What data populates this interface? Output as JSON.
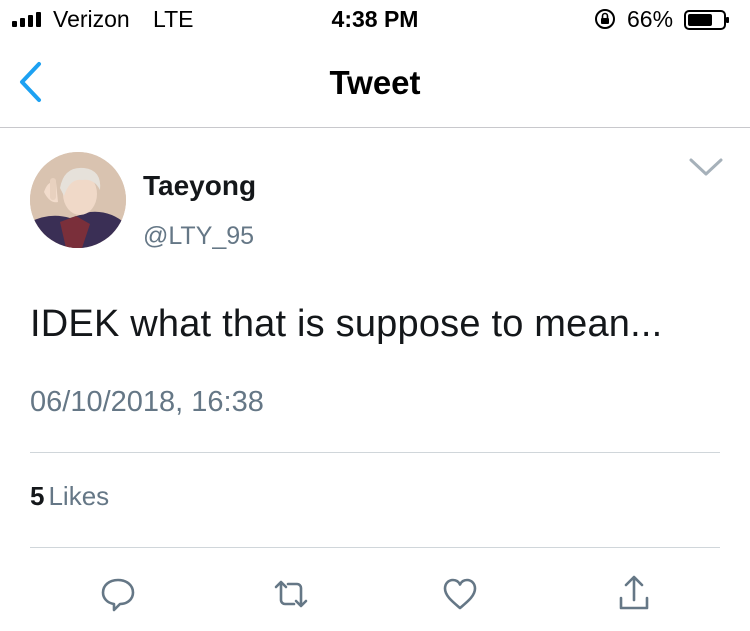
{
  "status_bar": {
    "carrier": "Verizon",
    "network": "LTE",
    "time": "4:38 PM",
    "battery_percent": "66%",
    "icons": [
      "signal-bars-icon",
      "orientation-lock-icon",
      "battery-icon"
    ]
  },
  "nav": {
    "title": "Tweet",
    "back_icon": "chevron-left-icon"
  },
  "tweet": {
    "author_name": "Taeyong",
    "author_handle": "@LTY_95",
    "text": "IDEK what that is suppose to mean...",
    "timestamp": "06/10/2018, 16:38",
    "likes_count": "5",
    "likes_label": "Likes",
    "menu_icon": "chevron-down-icon"
  },
  "actions": [
    {
      "icon": "reply-icon"
    },
    {
      "icon": "retweet-icon"
    },
    {
      "icon": "like-icon"
    },
    {
      "icon": "share-icon"
    }
  ],
  "colors": {
    "accent": "#1da1f2",
    "secondary_text": "#657786",
    "icon_gray": "#657786",
    "divider": "#d0d6da"
  }
}
